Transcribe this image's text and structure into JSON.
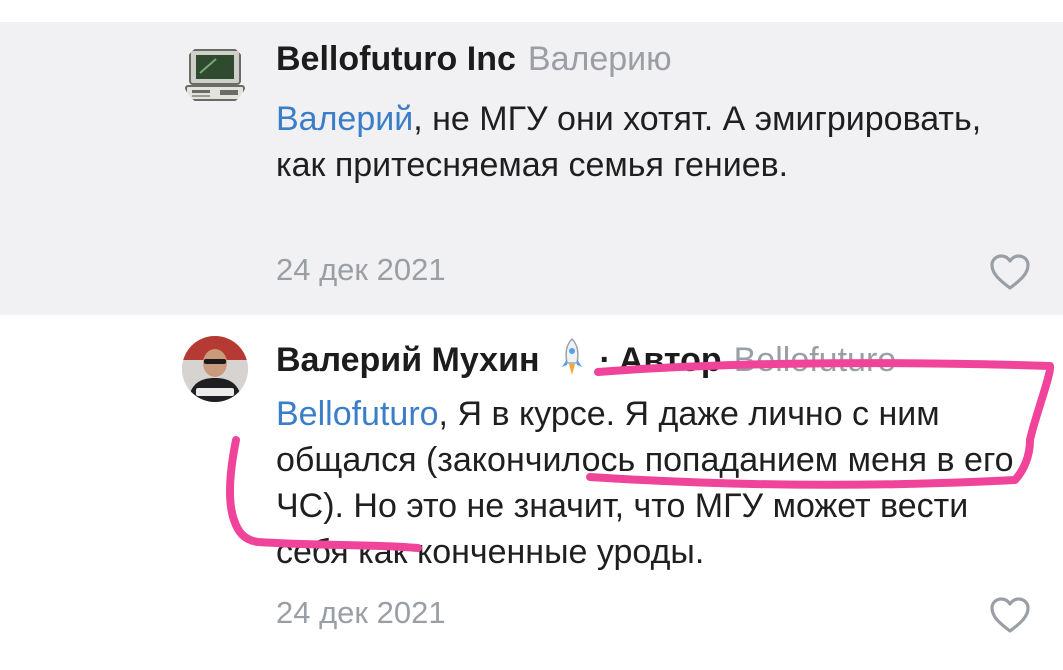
{
  "comments": [
    {
      "author": "Bellofuturo Inc",
      "reply_to": "Валерию",
      "mention": "Валерий",
      "text": ", не МГУ они хотят. А эмигрировать, как притесняемая семья гениев.",
      "date": "24 дек 2021",
      "avatar_icon": "retro-computer-icon",
      "like_icon": "heart-outline-icon"
    },
    {
      "author": "Валерий Мухин",
      "separator": "·",
      "badge": "Автор",
      "reply_to": "Bellofuturo",
      "mention": "Bellofuturo",
      "text": ", Я в курсе. Я даже лично с ним общался (закончилось попаданием меня в его ЧС). Но это не значит, что МГУ может вести себя как конченные уроды.",
      "date": "24 дек 2021",
      "avatar_icon": "user-photo-avatar",
      "status_icon": "rocket-icon",
      "like_icon": "heart-outline-icon"
    }
  ],
  "colors": {
    "background_highlighted": "#f1f1f3",
    "mention": "#3a7dc9",
    "secondary_text": "#9a9ea5",
    "annotation_marker": "#f0449a"
  }
}
